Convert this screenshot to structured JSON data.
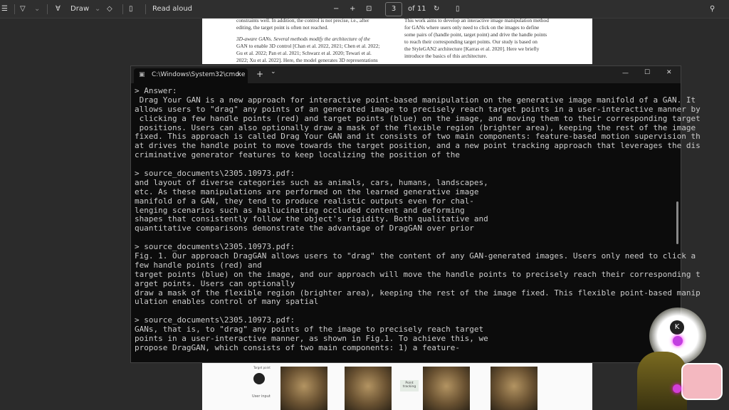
{
  "toolbar": {
    "draw_label": "Draw",
    "read_aloud_label": "Read aloud",
    "zoom_out": "−",
    "zoom_in": "+",
    "page_current": "3",
    "page_total": "of 11"
  },
  "pdf_top": {
    "left": [
      "constraints well. In addition, the control is not precise, i.e., after",
      "editing, the target point is often not reached.",
      "",
      "3D-aware GANs. Several methods modify the architecture of the",
      "GAN to enable 3D control [Chan et al. 2022, 2021; Chen et al. 2022;",
      "Gu et al. 2022; Pan et al. 2021; Schwarz et al. 2020; Tewari et al.",
      "2022; Xu et al. 2022]. Here, the model generates 3D representations"
    ],
    "right": [
      "This work aims to develop an interactive image manipulation method",
      "for GANs where users only need to click on the images to define",
      "some pairs of (handle point, target point) and drive the handle points",
      "to reach their corresponding target points. Our study is based on",
      "the StyleGAN2 architecture [Karras et al. 2020]. Here we briefly",
      "introduce the basics of this architecture."
    ]
  },
  "pdf_figure": {
    "legend": "Target point",
    "user_input": "User input",
    "point_tracking": "Point tracking"
  },
  "terminal": {
    "tab_title": "C:\\Windows\\System32\\cmd.e",
    "close_tab": "×",
    "new_tab": "+",
    "dropdown": "⌄",
    "minimize": "—",
    "maximize": "☐",
    "close": "✕",
    "lines": [
      "> Answer:",
      " Drag Your GAN is a new approach for interactive point-based manipulation on the generative image manifold of a GAN. It",
      "allows users to \"drag\" any points of an generated image to precisely reach target points in a user-interactive manner by",
      " clicking a few handle points (red) and target points (blue) on the image, and moving them to their corresponding target",
      " positions. Users can also optionally draw a mask of the flexible region (brighter area), keeping the rest of the image",
      "fixed. This approach is called Drag Your GAN and it consists of two main components: feature-based motion supervision th",
      "at drives the handle point to move towards the target position, and a new point tracking approach that leverages the dis",
      "criminative generator features to keep localizing the position of the",
      "",
      "> source_documents\\2305.10973.pdf:",
      "and layout of diverse categories such as animals, cars, humans, landscapes,",
      "etc. As these manipulations are performed on the learned generative image",
      "manifold of a GAN, they tend to produce realistic outputs even for chal-",
      "lenging scenarios such as hallucinating occluded content and deforming",
      "shapes that consistently follow the object's rigidity. Both qualitative and",
      "quantitative comparisons demonstrate the advantage of DragGAN over prior",
      "",
      "> source_documents\\2305.10973.pdf:",
      "Fig. 1. Our approach DragGAN allows users to \"drag\" the content of any GAN-generated images. Users only need to click a",
      "few handle points (red) and",
      "target points (blue) on the image, and our approach will move the handle points to precisely reach their corresponding t",
      "arget points. Users can optionally",
      "draw a mask of the flexible region (brighter area), keeping the rest of the image fixed. This flexible point-based manip",
      "ulation enables control of many spatial",
      "",
      "> source_documents\\2305.10973.pdf:",
      "GANs, that is, to \"drag\" any points of the image to precisely reach target",
      "points in a user-interactive manner, as shown in Fig.1. To achieve this, we",
      "propose DragGAN, which consists of two main components: 1) a feature-"
    ]
  },
  "avatar": {
    "badge": "K"
  }
}
